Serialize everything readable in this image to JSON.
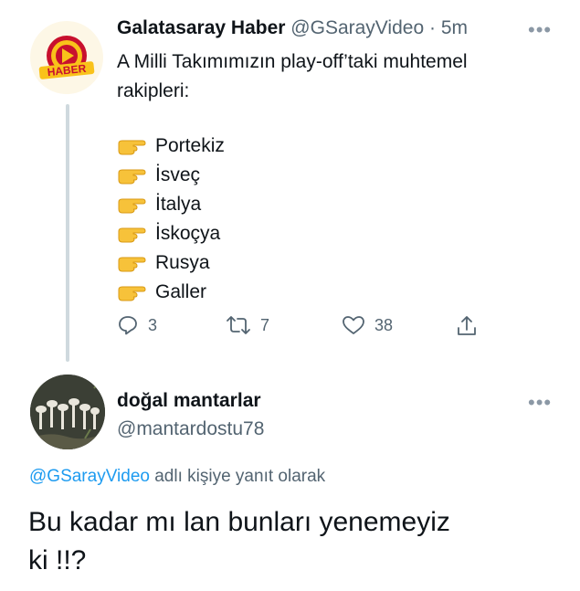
{
  "tweet1": {
    "author_name": "Galatasaray Haber",
    "handle": "@GSarayVideo",
    "separator": "·",
    "time": "5m",
    "more_icon": "more-dots-icon",
    "avatar_logo_text": "HABER",
    "text_line1": "A Milli Takımımızın play-off’taki muhtemel",
    "text_line2": "rakipleri:",
    "list_icon": "pointing-right-hand-icon",
    "list": [
      "Portekiz",
      "İsveç",
      "İtalya",
      "İskoçya",
      "Rusya",
      "Galler"
    ],
    "actions": {
      "reply_count": "3",
      "retweet_count": "7",
      "like_count": "38"
    }
  },
  "tweet2": {
    "author_name": "doğal mantarlar",
    "handle": "@mantardostu78",
    "more_icon": "more-dots-icon",
    "reply_to_handle": "@GSarayVideo",
    "reply_to_suffix": " adlı kişiye yanıt olarak",
    "text_line1": "Bu kadar mı lan bunları yenemeyiz",
    "text_line2": "ki !!?"
  },
  "colors": {
    "link": "#1d9bf0",
    "muted": "#536471",
    "emoji": "#f7c23a",
    "logo_red": "#c8102e",
    "logo_yellow": "#f9c21a"
  }
}
